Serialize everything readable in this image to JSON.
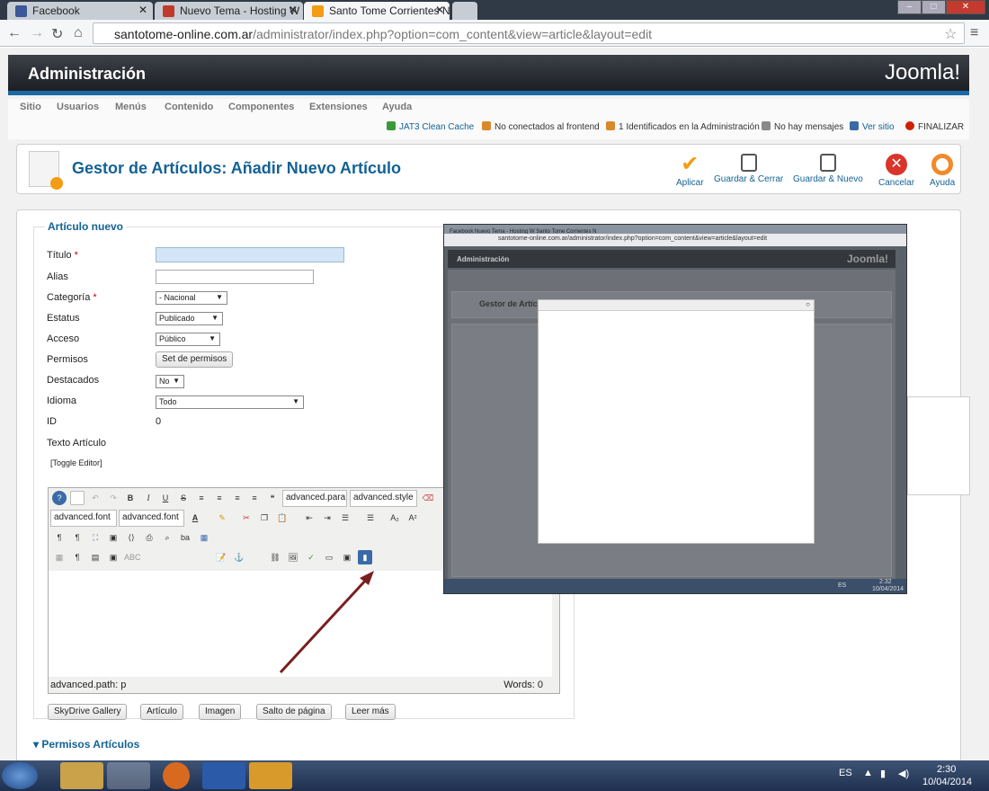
{
  "browser": {
    "tabs": [
      {
        "label": "Facebook",
        "color": "#3b5998"
      },
      {
        "label": "Nuevo Tema - Hosting W",
        "color": "#c0392b"
      },
      {
        "label": "Santo Tome Corrientes No",
        "color": "#f39c12"
      }
    ],
    "url_host": "santotome-online.com.ar",
    "url_path": "/administrator/index.php?option=com_content&view=article&layout=edit"
  },
  "header": {
    "title": "Administración",
    "logo": "Joomla!"
  },
  "menu": [
    "Sitio",
    "Usuarios",
    "Menús",
    "Contenido",
    "Componentes",
    "Extensiones",
    "Ayuda"
  ],
  "status": [
    {
      "label": "JAT3 Clean Cache",
      "color": "#3a9a3a",
      "link": true
    },
    {
      "label": "No conectados al frontend",
      "color": "#d88a2b",
      "link": false
    },
    {
      "label": "1 Identificados en la Administración",
      "color": "#d88a2b",
      "link": false
    },
    {
      "label": "No hay mensajes",
      "color": "#8a8a8a",
      "link": false
    },
    {
      "label": "Ver sitio",
      "color": "#3a6aa8",
      "link": true
    },
    {
      "label": "FINALIZAR",
      "color": "#cc2200",
      "link": false
    }
  ],
  "toolbar": {
    "title": "Gestor de Artículos: Añadir Nuevo Artículo",
    "buttons": [
      {
        "label": "Aplicar",
        "icon": "checkmark-icon",
        "color": "#f39c12"
      },
      {
        "label": "Guardar & Cerrar",
        "icon": "save-close-icon",
        "color": "#555"
      },
      {
        "label": "Guardar & Nuevo",
        "icon": "save-new-icon",
        "color": "#555"
      },
      {
        "label": "Cancelar",
        "icon": "cancel-icon",
        "color": "#d9352b"
      },
      {
        "label": "Ayuda",
        "icon": "help-icon",
        "color": "#f08a2b"
      }
    ]
  },
  "form": {
    "legend": "Artículo nuevo",
    "fields": {
      "titulo": "Título",
      "alias": "Alias",
      "categoria": "Categoría",
      "estatus": "Estatus",
      "acceso": "Acceso",
      "permisos": "Permisos",
      "destacados": "Destacados",
      "idioma": "Idioma",
      "id": "ID",
      "texto": "Texto Artículo"
    },
    "required_mark": "*",
    "values": {
      "categoria": "- Nacional",
      "estatus": "Publicado",
      "acceso": "Público",
      "permisos_button": "Set de permisos",
      "destacados": "No",
      "idioma": "Todo",
      "id": "0"
    },
    "toggle_editor": "[Toggle Editor]"
  },
  "editor": {
    "format_select": "advanced.para",
    "style_select": "advanced.style",
    "font_select": "advanced.font",
    "size_select": "advanced.font",
    "path": "advanced.path: p",
    "words": "Words: 0"
  },
  "editor_buttons": [
    "SkyDrive Gallery",
    "Artículo",
    "Imagen",
    "Salto de página",
    "Leer más"
  ],
  "permisos_section": "Permisos Artículos",
  "overlay": {
    "tabs": "Facebook   Nuevo Tema - Hosting W   Santo Tome Corrientes N",
    "url": "santotome-online.com.ar/administrator/index.php?option=com_content&view=article&layout=edit",
    "header": "Administración",
    "logo": "Joomla!",
    "title": "Gestor de Artículos",
    "close": "○",
    "lang": "ES",
    "time": "2:32",
    "date": "10/04/2014"
  },
  "taskbar": {
    "lang": "ES",
    "time": "2:30",
    "date": "10/04/2014"
  }
}
